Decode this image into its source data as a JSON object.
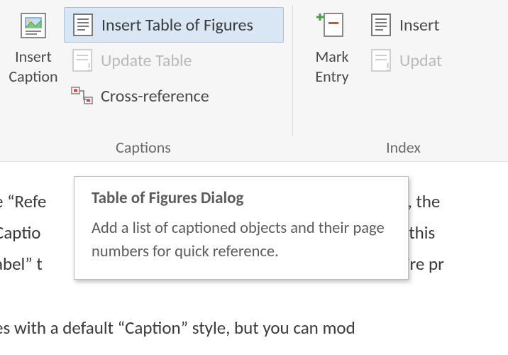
{
  "ribbon": {
    "captions_group": {
      "label": "Captions",
      "insert_caption": "Insert\nCaption",
      "insert_tof": "Insert Table of Figures",
      "update_table": "Update Table",
      "cross_reference": "Cross-reference"
    },
    "index_group": {
      "label": "Index",
      "mark_entry": "Mark\nEntry",
      "insert_index": "Insert ",
      "update_index": "Updat"
    }
  },
  "tooltip": {
    "title": "Table of Figures Dialog",
    "body": "Add a list of captioned objects and their page numbers for quick reference."
  },
  "doc": {
    "l1": "e “Refe",
    "r1": "n”, the",
    "l2": "Captio",
    "r2": "e; this",
    "l3": "abel” t",
    "r3": "y’re pr",
    "line5": "es with a default “Caption” style, but you can mod"
  }
}
